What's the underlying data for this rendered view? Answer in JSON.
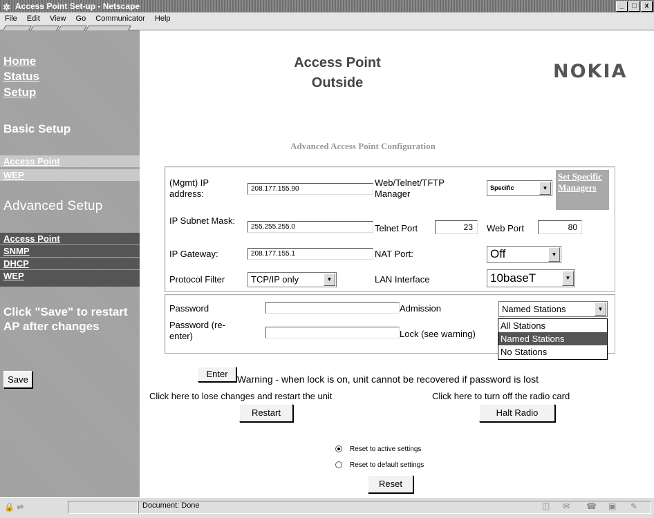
{
  "window": {
    "title": "Access Point Set-up - Netscape",
    "controls": [
      "_",
      "□",
      "x"
    ]
  },
  "menu": [
    "File",
    "Edit",
    "View",
    "Go",
    "Communicator",
    "Help"
  ],
  "sidebar": {
    "links": [
      "Home",
      "Status",
      "Setup"
    ],
    "basic_heading": "Basic Setup",
    "basic_items": [
      "Access Point",
      "WEP"
    ],
    "advanced_heading": "Advanced Setup",
    "advanced_items": [
      "Access Point",
      "SNMP",
      "DHCP",
      "WEP"
    ],
    "note": "Click \"Save\" to restart AP after changes",
    "save_label": "Save"
  },
  "header": {
    "title_line1": "Access Point",
    "title_line2": "Outside",
    "brand": "NOKIA",
    "subtitle": "Advanced Access Point Configuration"
  },
  "form": {
    "ip_label": "(Mgmt) IP address:",
    "ip_value": "208.177.155.90",
    "mask_label": "IP Subnet Mask:",
    "mask_value": "255.255.255.0",
    "gateway_label": "IP Gateway:",
    "gateway_value": "208.177.155.1",
    "protocol_label": "Protocol Filter",
    "protocol_value": "TCP/IP only",
    "manager_label": "Web/Telnet/TFTP Manager",
    "manager_value": "Specific",
    "managers_link": "Set Specific Managers",
    "telnet_label": "Telnet Port",
    "telnet_value": "23",
    "web_label": "Web Port",
    "web_value": "80",
    "nat_label": "NAT Port:",
    "nat_value": "Off",
    "lan_label": "LAN Interface",
    "lan_value": "10baseT"
  },
  "security": {
    "password_label": "Password",
    "password_reenter_label": "Password (re-enter)",
    "admission_label": "Admission",
    "admission_value": "Named Stations",
    "admission_options": [
      "All Stations",
      "Named Stations",
      "No Stations"
    ],
    "lock_label": "Lock (see warning)"
  },
  "actions": {
    "enter_label": "Enter",
    "warning": "Warning - when lock is on, unit cannot be recovered if password is lost",
    "restart_hint": "Click here to lose changes and restart the unit",
    "restart_label": "Restart",
    "halt_hint": "Click here to turn off the radio card",
    "halt_label": "Halt Radio",
    "reset_active": "Reset to active settings",
    "reset_default": "Reset to default settings",
    "reset_label": "Reset"
  },
  "status": {
    "text": "Document: Done"
  }
}
